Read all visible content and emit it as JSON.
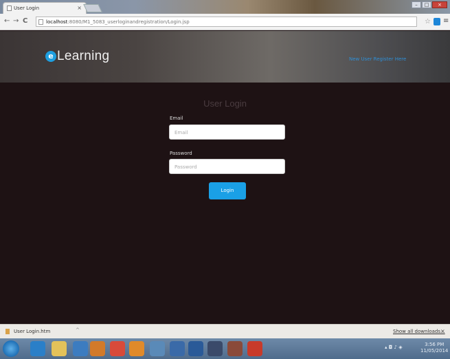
{
  "browser": {
    "tab_title": "User Login",
    "tab_close": "×",
    "url_host": "localhost",
    "url_path": ":8080/M1_5083_userloginandregistration/Login.jsp",
    "menu_glyph": "≡",
    "star_glyph": "☆"
  },
  "header": {
    "logo_text": "Learning",
    "logo_mark": "e",
    "register_link": "New User Register Here"
  },
  "login": {
    "title": "User Login",
    "email_label": "Email",
    "email_placeholder": "Email",
    "password_label": "Password",
    "password_placeholder": "Password",
    "button": "Login"
  },
  "downloads": {
    "item": "User Login.htm",
    "caret": "^",
    "show_all": "Show all downloads...",
    "close": "×"
  },
  "taskbar": {
    "time": "3:56 PM",
    "date": "11/05/2014"
  },
  "colors": {
    "accent": "#1aa0e6",
    "page_bg": "#1e1214",
    "link": "#2f8fd6"
  }
}
